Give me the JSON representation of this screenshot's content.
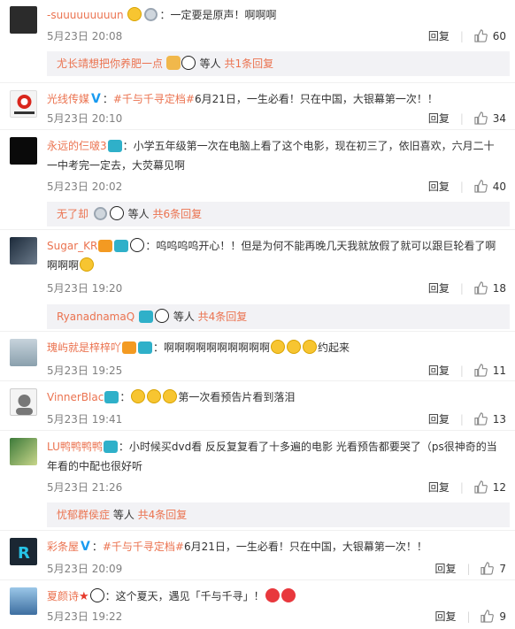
{
  "ui": {
    "reply_label": "回复",
    "accent_color": "#eb7350",
    "meta_color": "#808080",
    "subbar_bg": "#f2f2f5"
  },
  "comments": [
    {
      "user": "-suuuuuuuuun",
      "text": "：一定要是原声！啊啊啊",
      "time": "5月23日 20:08",
      "likes": "60",
      "subbar": {
        "names": "尤长靖想把你养肥一点",
        "suffix": " 等人 ",
        "more": "共1条回复"
      }
    },
    {
      "user": "光线传媒",
      "hashtag": "#千与千寻定档#",
      "text": "6月21日，一生必看！只在中国，大银幕第一次！！",
      "time": "5月23日 20:10",
      "likes": "34"
    },
    {
      "user": "永远的仨啵3",
      "text": "：小学五年级第一次在电脑上看了这个电影，现在初三了，依旧喜欢，六月二十一中考完一定去，大荧幕见啊",
      "time": "5月23日 20:02",
      "likes": "40",
      "subbar": {
        "names": "无了却",
        "suffix": " 等人 ",
        "more": "共6条回复"
      }
    },
    {
      "user": "Sugar_KR",
      "text": "：呜呜呜呜开心！！但是为何不能再晚几天我就放假了就可以跟巨轮看了啊啊啊啊",
      "time": "5月23日 19:20",
      "likes": "18",
      "subbar": {
        "names": "RyanadnamaQ",
        "suffix": " 等人 ",
        "more": "共4条回复"
      }
    },
    {
      "user": "瑰屿就是梓梓吖",
      "text": "：啊啊啊啊啊啊啊啊啊啊",
      "text2": "约起来",
      "time": "5月23日 19:25",
      "likes": "11"
    },
    {
      "user": "VinnerBlac",
      "text": "：",
      "text2": "第一次看预告片看到落泪",
      "time": "5月23日 19:41",
      "likes": "13"
    },
    {
      "user": "LU鸭鸭鸭鸭",
      "text": "：小时候买dvd看 反反复复看了十多遍的电影 光看预告都要哭了（ps很神奇的当年看的中配也很好听",
      "time": "5月23日 21:26",
      "likes": "12",
      "subbar": {
        "names": "忧郁群侯症",
        "suffix": " 等人 ",
        "more": "共4条回复"
      }
    },
    {
      "user": "彩条屋",
      "hashtag": "#千与千寻定档#",
      "text": "6月21日，一生必看！只在中国，大银幕第一次！！",
      "time": "5月23日 20:09",
      "likes": "7"
    },
    {
      "user": "夏颜诗",
      "text": "：这个夏天，遇见「千与千寻」！",
      "time": "5月23日 19:22",
      "likes": "9"
    }
  ]
}
